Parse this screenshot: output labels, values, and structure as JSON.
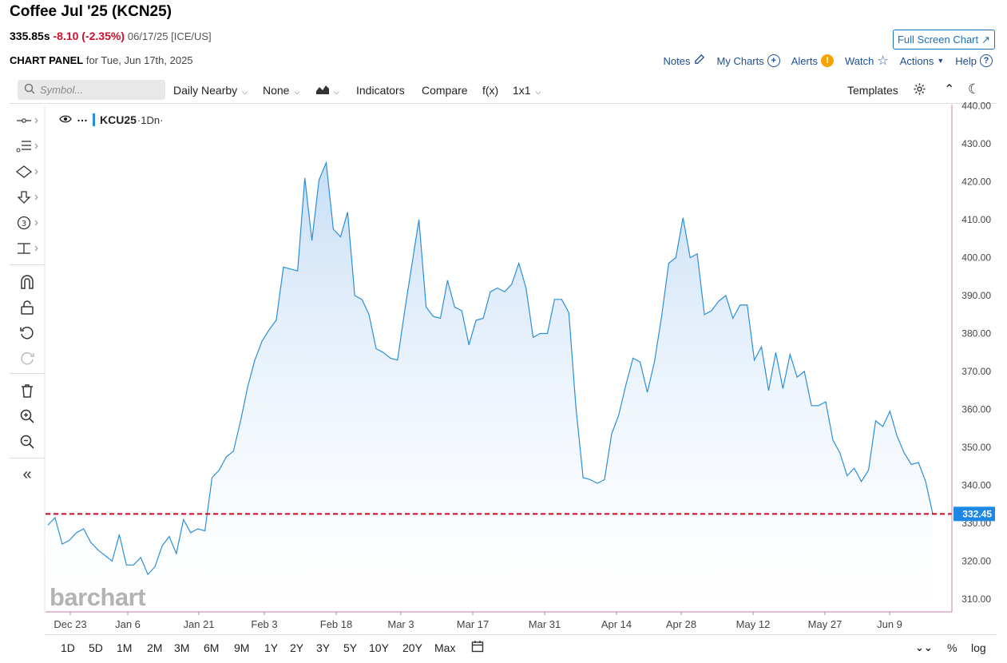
{
  "header": {
    "title": "Coffee Jul '25 (KCN25)",
    "price": "335.85s",
    "change": "-8.10 (-2.35%)",
    "meta": "06/17/25 [ICE/US]",
    "fullscreen_label": "Full Screen Chart",
    "panel_label": "CHART PANEL",
    "panel_date": "for Tue, Jun 17th, 2025"
  },
  "links": {
    "notes": "Notes",
    "my_charts": "My Charts",
    "alerts": "Alerts",
    "watch": "Watch",
    "actions": "Actions",
    "help": "Help"
  },
  "toolbar": {
    "search_placeholder": "Symbol...",
    "daily": "Daily Nearby",
    "none": "None",
    "indicators": "Indicators",
    "compare": "Compare",
    "fx": "f(x)",
    "layout": "1x1",
    "templates": "Templates"
  },
  "legend": {
    "symbol": "KCU25",
    "interval": "·1Dn·"
  },
  "watermark": "barchart",
  "colors": {
    "line": "#2a8fd8",
    "fill_top": "#cfe4f8",
    "ref_line": "#d0021b",
    "price_tag": "#1e88e5",
    "axis_border": "#d17ab3",
    "link": "#1d4f8f"
  },
  "bottombar": {
    "ranges": [
      "1D",
      "5D",
      "1M",
      "2M",
      "3M",
      "6M",
      "9M",
      "1Y",
      "2Y",
      "3Y",
      "5Y",
      "10Y",
      "20Y",
      "Max"
    ],
    "percent": "%",
    "log": "log"
  },
  "chart_data": {
    "type": "area",
    "y_ticks": [
      "440.00",
      "430.00",
      "420.00",
      "410.00",
      "400.00",
      "390.00",
      "380.00",
      "370.00",
      "360.00",
      "350.00",
      "340.00",
      "330.00",
      "320.00",
      "310.00"
    ],
    "ylim": [
      306,
      441
    ],
    "x_tick_labels": [
      "Dec 23",
      "Jan 6",
      "Jan 21",
      "Feb 3",
      "Feb 18",
      "Mar 3",
      "Mar 17",
      "Mar 31",
      "Apr 14",
      "Apr 28",
      "May 12",
      "May 27",
      "Jun 9"
    ],
    "last_price_label": "332.45",
    "last_price": 332.45,
    "series": [
      {
        "values": [
          329.5,
          331.5,
          324.5,
          325.5,
          327.5,
          328.5,
          325.0,
          323.0,
          321.5,
          320.0,
          327.0,
          319.0,
          319.0,
          321.0,
          316.5,
          318.5,
          324.0,
          326.5,
          322.0,
          331.0,
          327.5,
          328.5,
          328.0,
          342.0,
          344.0,
          347.5,
          349.0,
          357.0,
          366.0,
          373.0,
          378.0,
          381.0,
          383.5,
          397.5,
          397.0,
          396.5,
          421.0,
          404.5,
          420.5,
          425.0,
          407.5,
          405.5,
          412.0,
          390.0,
          389.0,
          385.0,
          376.0,
          375.0,
          373.5,
          373.0,
          386.0,
          398.0,
          410.0,
          387.0,
          384.5,
          384.0,
          394.0,
          387.0,
          386.0,
          377.0,
          383.5,
          384.0,
          391.0,
          392.0,
          391.0,
          393.0,
          398.5,
          392.0,
          379.0,
          380.0,
          380.0,
          389.0,
          389.0,
          385.5,
          360.5,
          342.0,
          341.5,
          340.5,
          341.5,
          353.5,
          358.5,
          366.5,
          373.5,
          372.5,
          364.5,
          372.5,
          384.5,
          398.5,
          400.0,
          410.5,
          400.0,
          401.0,
          385.0,
          386.0,
          388.5,
          390.0,
          384.0,
          387.5,
          387.5,
          373.0,
          376.5,
          365.0,
          375.0,
          365.5,
          374.5,
          368.5,
          370.0,
          361.0,
          361.0,
          362.0,
          352.0,
          348.5,
          342.5,
          344.5,
          341.0,
          344.0,
          357.0,
          355.5,
          359.5,
          353.0,
          348.5,
          345.5,
          346.0,
          341.0,
          332.45
        ]
      }
    ]
  }
}
